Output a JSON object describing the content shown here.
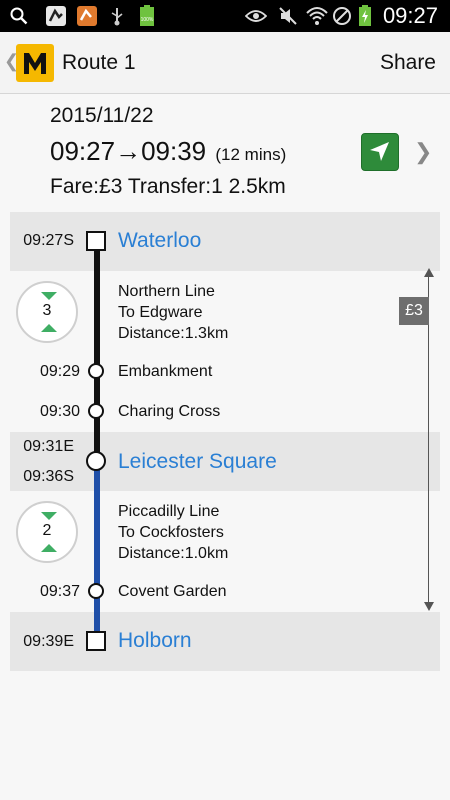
{
  "status_bar": {
    "time": "09:27",
    "battery_level": "100%",
    "icons": [
      "search-icon",
      "app-notification-icon",
      "app-notification-icon",
      "usb-icon",
      "battery-full-icon",
      "eye-icon",
      "mute-icon",
      "wifi-icon",
      "no-sim-icon",
      "battery-charging-icon"
    ]
  },
  "action_bar": {
    "title": "Route 1",
    "share_label": "Share",
    "logo_letter": "M",
    "brand_color": "#f5b800"
  },
  "summary": {
    "date": "2015/11/22",
    "depart": "09:27",
    "arrow": "→",
    "arrive": "09:39",
    "duration": "(12 mins)",
    "fare_line": "Fare:£3 Transfer:1 2.5km"
  },
  "route": {
    "fare_badge": "£3",
    "start": {
      "time": "09:27S",
      "name": "Waterloo"
    },
    "leg1": {
      "stops_count": "3",
      "line": "Northern Line",
      "direction": "To Edgware",
      "distance": "Distance:1.3km",
      "line_color": "#111111",
      "stops": [
        {
          "time": "09:29",
          "name": "Embankment"
        },
        {
          "time": "09:30",
          "name": "Charing Cross"
        }
      ]
    },
    "transfer": {
      "arrive_time": "09:31E",
      "depart_time": "09:36S",
      "name": "Leicester Square"
    },
    "leg2": {
      "stops_count": "2",
      "line": "Piccadilly Line",
      "direction": "To Cockfosters",
      "distance": "Distance:1.0km",
      "line_color": "#1f4fa8",
      "stops": [
        {
          "time": "09:37",
          "name": "Covent Garden"
        }
      ]
    },
    "end": {
      "time": "09:39E",
      "name": "Holborn"
    }
  }
}
